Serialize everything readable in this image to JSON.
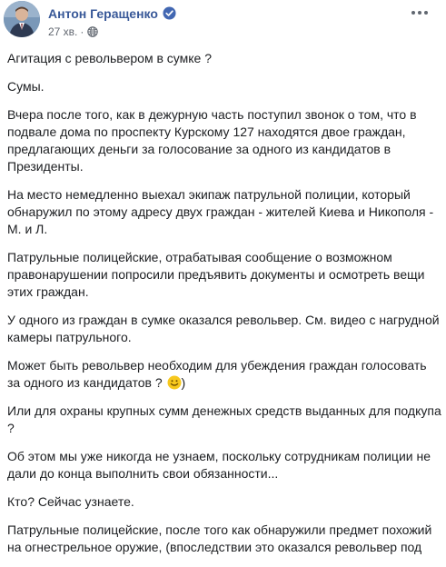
{
  "author": {
    "name": "Антон Геращенко",
    "verified": true
  },
  "post": {
    "time": "27 хв.",
    "separator": "·",
    "privacy_icon": "globe-icon",
    "more_icon": "more-options-icon",
    "paragraphs": [
      "Агитация с револьвером в сумке ?",
      "Сумы.",
      "Вчера после того, как в дежурную часть поступил звонок о том, что в подвале дома по проспекту Курскому 127 находятся двое граждан, предлагающих деньги за голосование за одного из кандидатов в Президенты.",
      "На место немедленно выехал экипаж патрульной полиции, который обнаружил по этому адресу двух граждан - жителей Киева и Никополя - М. и Л.",
      "Патрульные полицейские, отрабатывая сообщение о возможном правонарушении попросили предъявить документы и осмотреть вещи этих граждан.",
      "У одного из граждан в сумке оказался револьвер. См. видео с нагрудной камеры патрульного.",
      "Может быть револьвер необходим для убеждения граждан голосовать за одного из кандидатов ?",
      "Или для охраны крупных сумм денежных средств выданных для подкупа ?",
      "Об этом мы уже никогда не узнаем, поскольку сотрудникам полиции не дали до конца выполнить свои обязанности...",
      "Кто? Сейчас узнаете.",
      "Патрульные полицейские, после того как обнаружили предмет похожий на огнестрельное оружие, (впоследствии это оказался револьвер под"
    ],
    "emoji_after_paragraph": "smiley-emoji"
  },
  "colors": {
    "author_link": "#385898",
    "verified": "#1877f2",
    "meta_text": "#616770",
    "body_text": "#1c1e21"
  }
}
